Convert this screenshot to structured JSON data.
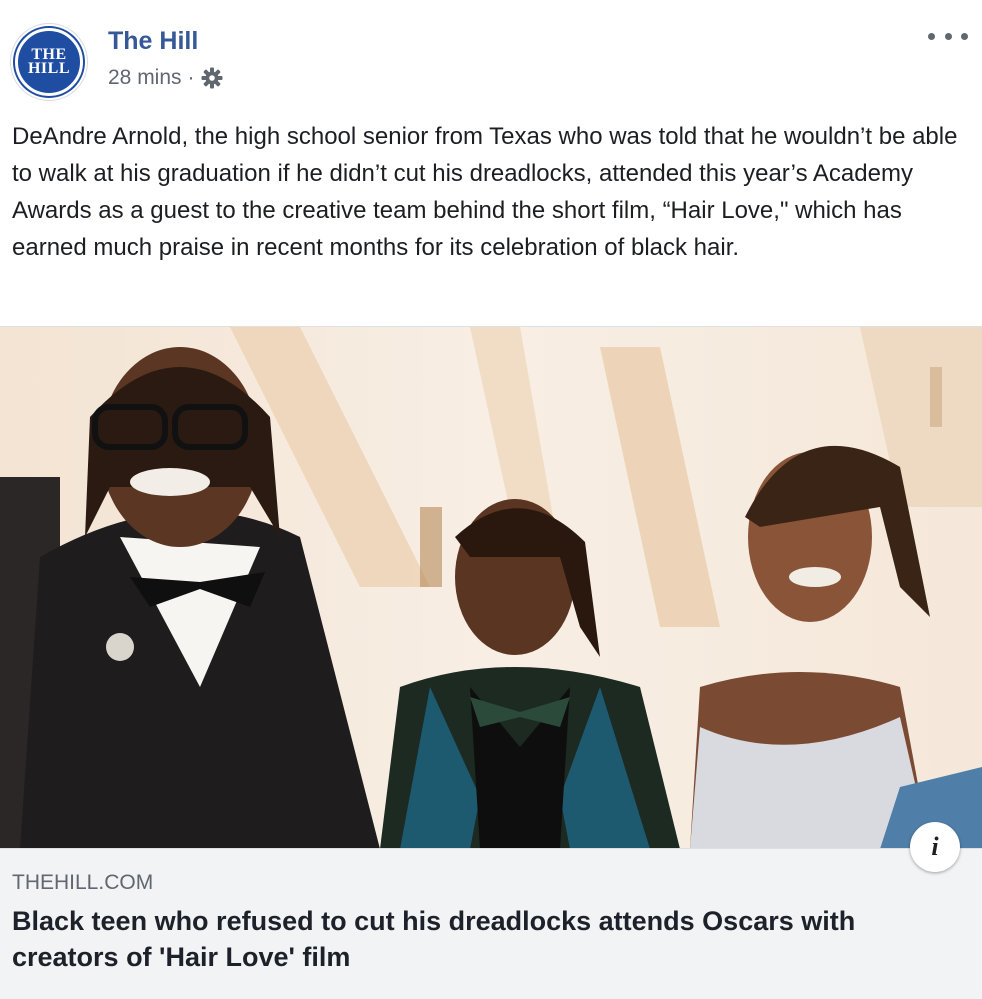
{
  "post": {
    "page_name": "The Hill",
    "timestamp": "28 mins",
    "separator": "·",
    "audience_icon": "gear-icon",
    "avatar_text_line1": "THE",
    "avatar_text_line2": "HILL",
    "text": "DeAndre Arnold, the high school senior from Texas who was told that he wouldn’t be able to walk at his graduation if he didn’t cut his dreadlocks, attended this year’s Academy Awards as a guest to the creative team behind the short film, “Hair Love,\" which has earned much praise in recent months for its celebration of black hair."
  },
  "link": {
    "domain": "THEHILL.COM",
    "headline": "Black teen who refused to cut his dreadlocks attends Oscars with creators of 'Hair Love' film",
    "info_icon": "i"
  },
  "colors": {
    "brand": "#1f4da1",
    "page_name": "#365899",
    "meta": "#606770",
    "link_box_bg": "#f2f3f5"
  }
}
